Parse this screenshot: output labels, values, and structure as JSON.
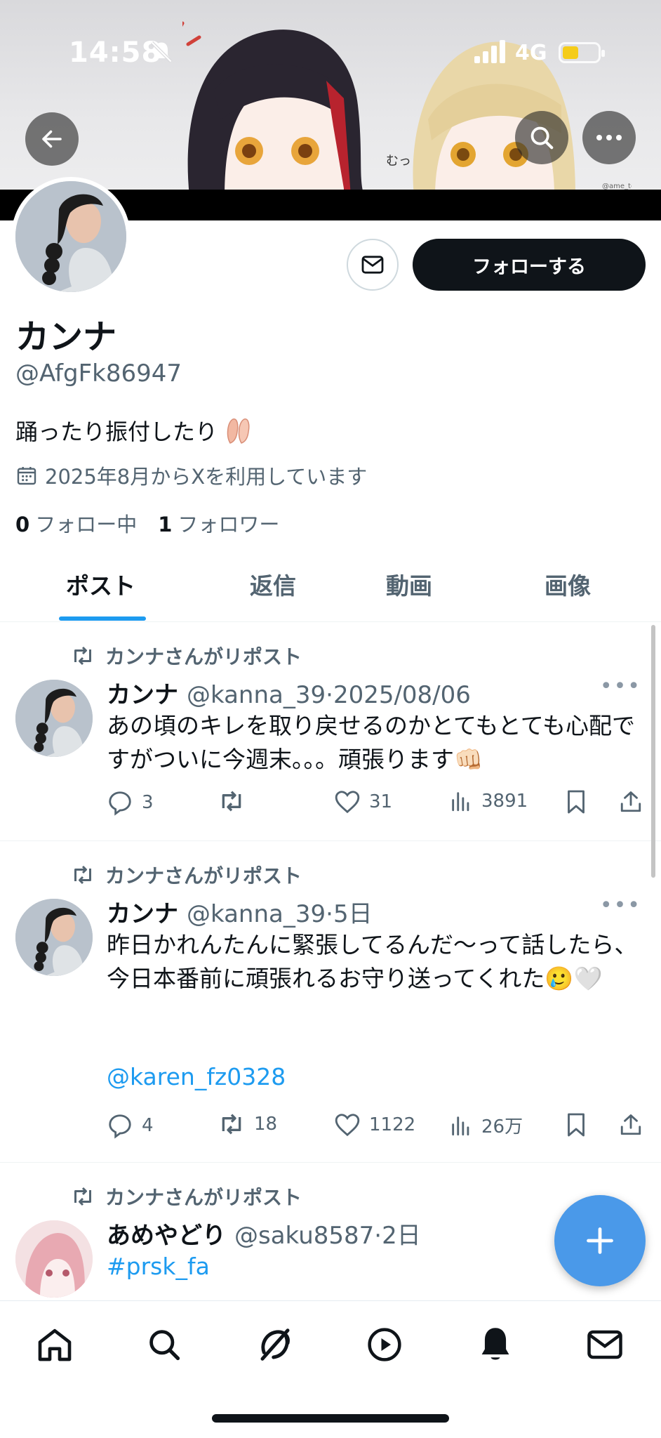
{
  "status_bar": {
    "time": "14:58",
    "network": "4G"
  },
  "profile": {
    "name": "カンナ",
    "handle": "@AfgFk86947",
    "bio": "踊ったり振付したり",
    "joined": "2025年8月からXを利用しています",
    "following_count": "0",
    "following_label": "フォロー中",
    "followers_count": "1",
    "followers_label": "フォロワー",
    "follow_button": "フォローする"
  },
  "tabs": [
    {
      "label": "ポスト",
      "active": true
    },
    {
      "label": "返信",
      "active": false
    },
    {
      "label": "動画",
      "active": false
    },
    {
      "label": "画像",
      "active": false
    }
  ],
  "posts": [
    {
      "repost_label": "カンナさんがリポスト",
      "name": "カンナ",
      "handle": "@kanna_39",
      "sep": "·",
      "time": "2025/08/06",
      "text": "あの頃のキレを取り戻せるのかとてもとても心配ですがついに今週末。。。頑張ります👊🏻",
      "replies": "3",
      "reposts": "",
      "likes": "31",
      "views": "3891"
    },
    {
      "repost_label": "カンナさんがリポスト",
      "name": "カンナ",
      "handle": "@kanna_39",
      "sep": "·",
      "time": "5日",
      "text": "昨日かれんたんに緊張してるんだ〜って話したら、今日本番前に頑張れるお守り送ってくれた🥲🤍",
      "mention": "@karen_fz0328",
      "replies": "4",
      "reposts": "18",
      "likes": "1122",
      "views": "26万"
    },
    {
      "repost_label": "カンナさんがリポスト",
      "name": "あめやどり",
      "handle": "@saku8587",
      "sep": "·",
      "time": "2日",
      "text": "#prsk_fa"
    }
  ],
  "banner_watermark": "@ame_tenshi",
  "banner_sfx": "むっ",
  "colors": {
    "accent": "#1d9bf0",
    "fab": "#4a99e9",
    "text": "#0f1419",
    "muted": "#536471"
  },
  "icons": [
    "back-arrow-icon",
    "search-icon",
    "more-icon",
    "mail-icon",
    "calendar-icon",
    "repost-icon",
    "reply-icon",
    "like-icon",
    "views-icon",
    "bookmark-icon",
    "share-icon",
    "plus-icon",
    "home-icon",
    "explore-icon",
    "grok-icon",
    "video-icon",
    "notifications-icon",
    "messages-icon"
  ]
}
